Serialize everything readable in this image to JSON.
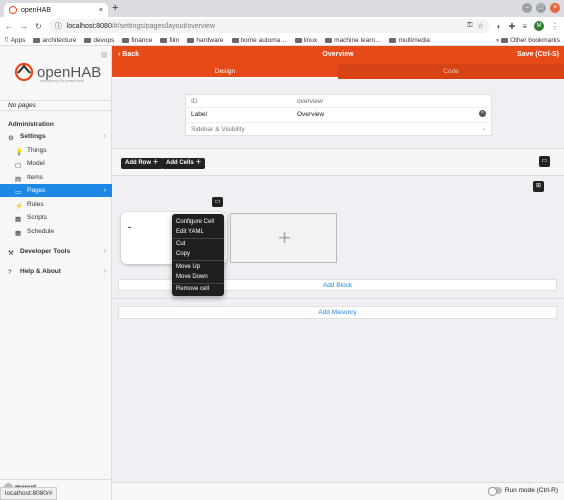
{
  "browser": {
    "tab_title": "openHAB",
    "new_tab": "+",
    "url_host": "localhost:8080",
    "url_path": "/#/settings/pages/layout/overview",
    "profile_initial": "M",
    "bookmarks": [
      "Apps",
      "architecture",
      "devops",
      "finance",
      "film",
      "hardware",
      "home automa…",
      "linux",
      "machine learn…",
      "multimedia"
    ],
    "other_bookmarks": "Other bookmarks"
  },
  "sidebar": {
    "brand": "openHAB",
    "brand_tagline": "empowering the smart home",
    "no_pages": "No pages",
    "section": "Administration",
    "items": [
      {
        "label": "Settings",
        "expanded": true
      },
      {
        "label": "Things"
      },
      {
        "label": "Model"
      },
      {
        "label": "Items"
      },
      {
        "label": "Pages",
        "active": true
      },
      {
        "label": "Rules"
      },
      {
        "label": "Scripts"
      },
      {
        "label": "Schedule"
      },
      {
        "label": "Developer Tools"
      },
      {
        "label": "Help & About"
      }
    ],
    "user": "marcel",
    "status_url": "localhost:8080/#"
  },
  "header": {
    "back": "Back",
    "title": "Overview",
    "save": "Save (Ctrl-S)",
    "tabs": [
      "Design",
      "Code"
    ]
  },
  "props": {
    "id_label": "ID",
    "id_value": "overview",
    "label_label": "Label",
    "label_value": "Overview",
    "sidebar_label": "Sidebar & Visibility"
  },
  "toolbar": {
    "add_row": "Add Row",
    "add_cells": "Add Cells"
  },
  "cell": {
    "title": "-"
  },
  "context_menu": {
    "items": [
      "Configure Cell",
      "Edit YAML",
      "Cut",
      "Copy",
      "Move Up",
      "Move Down",
      "Remove cell"
    ]
  },
  "actions": {
    "add_block": "Add Block",
    "add_masonry": "Add Masonry"
  },
  "footer": {
    "run_mode": "Run mode (Ctrl-R)"
  },
  "colors": {
    "accent": "#e64a19",
    "active": "#1e88e5"
  }
}
